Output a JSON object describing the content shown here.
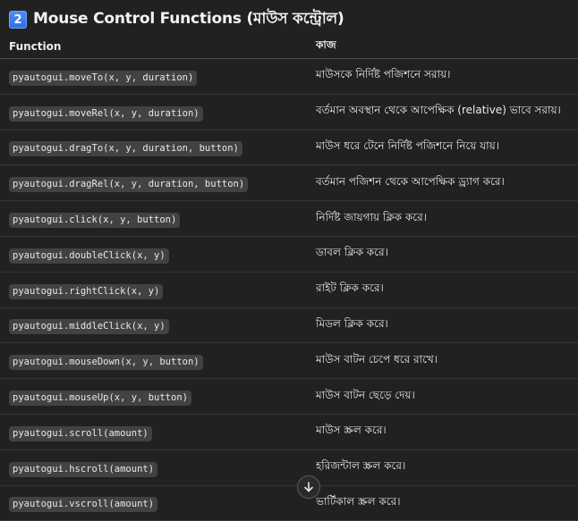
{
  "section": {
    "number": "2",
    "title": "Mouse Control Functions (মাউস কন্ট্রোল)"
  },
  "table": {
    "headers": [
      "Function",
      "কাজ"
    ],
    "rows": [
      {
        "function": "pyautogui.moveTo(x, y, duration)",
        "description": "মাউসকে নির্দিষ্ট পজিশনে সরায়।"
      },
      {
        "function": "pyautogui.moveRel(x, y, duration)",
        "description": "বর্তমান অবস্থান থেকে আপেক্ষিক (relative) ভাবে সরায়।"
      },
      {
        "function": "pyautogui.dragTo(x, y, duration, button)",
        "description": "মাউস ধরে টেনে নির্দিষ্ট পজিশনে নিয়ে যায়।"
      },
      {
        "function": "pyautogui.dragRel(x, y, duration, button)",
        "description": "বর্তমান পজিশন থেকে আপেক্ষিক ড্র্যাগ করে।"
      },
      {
        "function": "pyautogui.click(x, y, button)",
        "description": "নির্দিষ্ট জায়গায় ক্লিক করে।"
      },
      {
        "function": "pyautogui.doubleClick(x, y)",
        "description": "ডাবল ক্লিক করে।"
      },
      {
        "function": "pyautogui.rightClick(x, y)",
        "description": "রাইট ক্লিক করে।"
      },
      {
        "function": "pyautogui.middleClick(x, y)",
        "description": "মিডল ক্লিক করে।"
      },
      {
        "function": "pyautogui.mouseDown(x, y, button)",
        "description": "মাউস বাটন চেপে ধরে রাখে।"
      },
      {
        "function": "pyautogui.mouseUp(x, y, button)",
        "description": "মাউস বাটন ছেড়ে দেয়।"
      },
      {
        "function": "pyautogui.scroll(amount)",
        "description": "মাউস স্ক্রল করে।"
      },
      {
        "function": "pyautogui.hscroll(amount)",
        "description": "হরিজন্টাল স্ক্রল করে।"
      },
      {
        "function": "pyautogui.vscroll(amount)",
        "description": "ভার্টিকাল স্ক্রল করে।"
      }
    ]
  },
  "scroll_button": {
    "icon": "arrow-down-icon"
  },
  "colors": {
    "background": "#212121",
    "badge": "#3b82f6",
    "code_background": "#424242",
    "text": "#ececec"
  }
}
